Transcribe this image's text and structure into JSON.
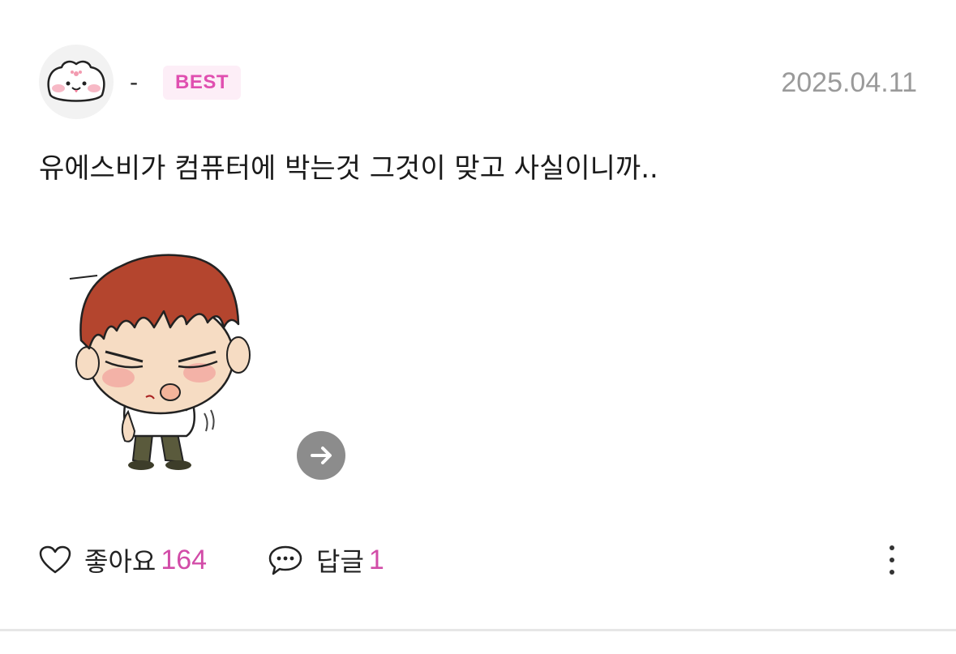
{
  "author": {
    "nickname": "-",
    "badge": "BEST",
    "date": "2025.04.11",
    "avatar_icon": "bunny-face-icon"
  },
  "comment": {
    "text": "유에스비가 컴퓨터에 박는것 그것이 맞고 사실이니까..",
    "sticker": "angry-red-hair-boy-sticker"
  },
  "actions": {
    "like_label": "좋아요",
    "like_count": "164",
    "reply_label": "답글",
    "reply_count": "1"
  },
  "colors": {
    "accent": "#d24ca8",
    "badge_bg": "#fdeef7",
    "date_gray": "#9a9a9a",
    "arrow_button": "#8c8c8c"
  }
}
